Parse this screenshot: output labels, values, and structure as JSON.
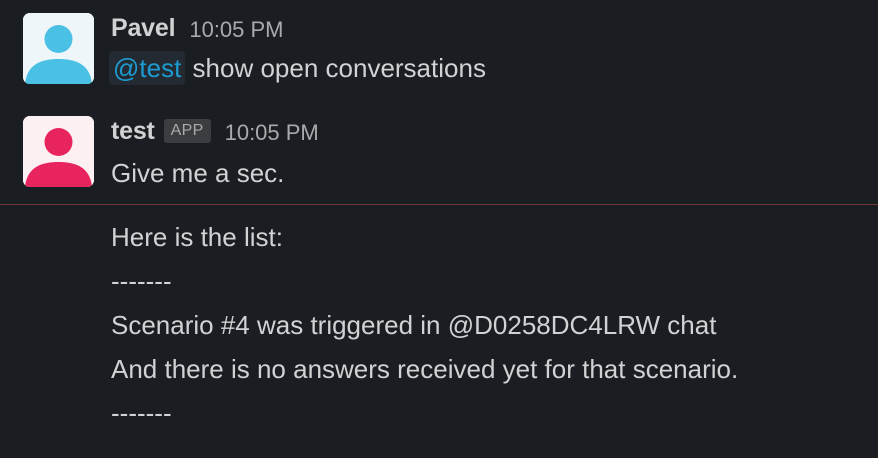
{
  "messages": [
    {
      "author": "Pavel",
      "timestamp": "10:05 PM",
      "avatar_color": "#4ac0e4",
      "avatar_bg": "#e8f4fa",
      "mention": "@test",
      "text": " show open conversations"
    },
    {
      "author": "test",
      "badge": "APP",
      "timestamp": "10:05 PM",
      "avatar_color": "#e8245f",
      "avatar_bg": "#fde9ee",
      "text": "Give me a sec."
    }
  ],
  "continuation_lines": [
    "Here is the list:",
    "-------",
    "Scenario #4 was triggered in @D0258DC4LRW chat",
    "And there is no answers received yet for that scenario.",
    "-------"
  ],
  "colors": {
    "background": "#1a1d21",
    "text": "#d1d2d3",
    "muted": "#a9aaab",
    "mention": "#1d9bd1",
    "new_divider": "#6e3a30"
  }
}
